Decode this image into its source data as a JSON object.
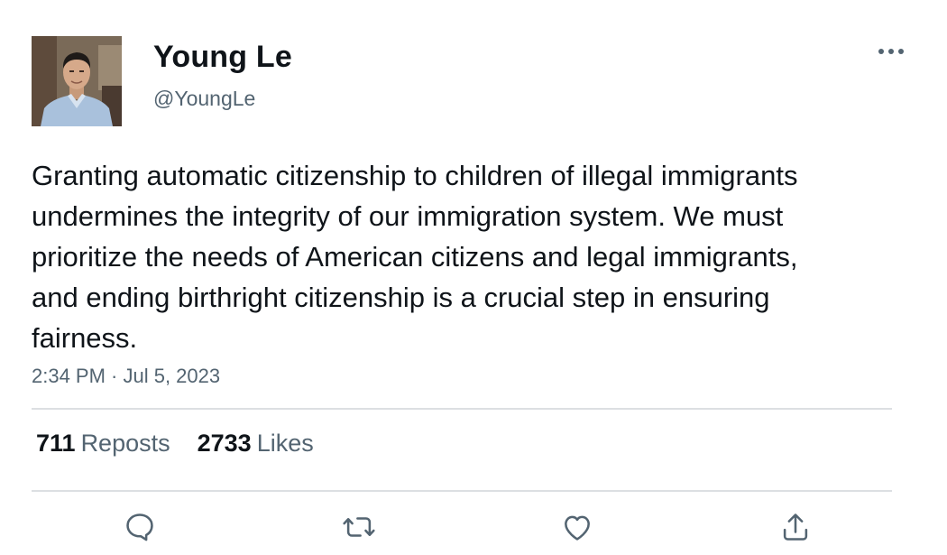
{
  "author": {
    "display_name": "Young Le",
    "handle": "@YoungLe",
    "avatar_icon": "profile-photo"
  },
  "tweet": {
    "text": "Granting automatic citizenship to children of illegal immigrants undermines the integrity of our immigration system. We must prioritize the needs of American citizens and legal immigrants, and ending birthright citizenship is a crucial step in ensuring fairness.",
    "timestamp": "2:34 PM · Jul 5, 2023"
  },
  "stats": {
    "reposts_count": "711",
    "reposts_label": "Reposts",
    "likes_count": "2733",
    "likes_label": "Likes"
  },
  "actions": [
    {
      "name": "reply",
      "icon": "speech-bubble-icon"
    },
    {
      "name": "repost",
      "icon": "repost-arrows-icon"
    },
    {
      "name": "like",
      "icon": "heart-icon"
    },
    {
      "name": "share",
      "icon": "share-upload-icon"
    }
  ],
  "more_icon": "ellipsis-icon",
  "colors": {
    "text_primary": "#0f1419",
    "text_secondary": "#536471",
    "divider": "#dcdfe2",
    "icon": "#536471"
  }
}
